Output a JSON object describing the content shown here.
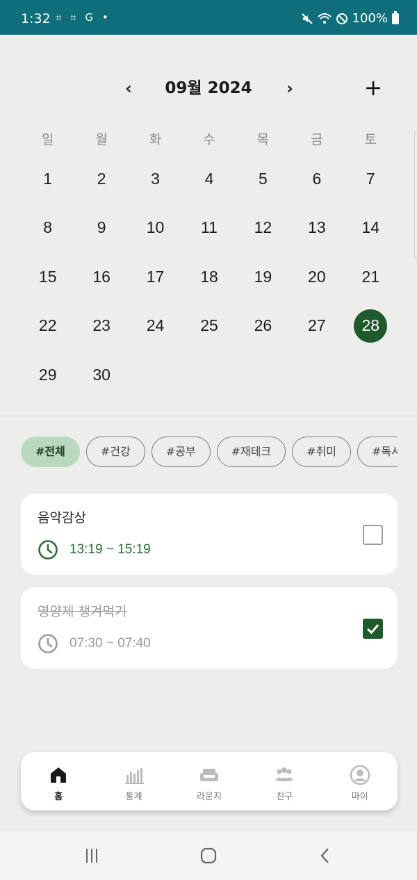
{
  "status_bar": {
    "time": "1:32",
    "left_icons": "⌗ ⌗ G •",
    "battery": "100%"
  },
  "calendar": {
    "title": "09월 2024",
    "prev": "‹",
    "next": "›",
    "add": "+",
    "weekdays": [
      "일",
      "월",
      "화",
      "수",
      "목",
      "금",
      "토"
    ],
    "days": [
      "1",
      "2",
      "3",
      "4",
      "5",
      "6",
      "7",
      "8",
      "9",
      "10",
      "11",
      "12",
      "13",
      "14",
      "15",
      "16",
      "17",
      "18",
      "19",
      "20",
      "21",
      "22",
      "23",
      "24",
      "25",
      "26",
      "27",
      "28",
      "29",
      "30"
    ],
    "selected_day": "28",
    "accent_color": "#1f5a2c"
  },
  "filters": {
    "chips": [
      {
        "label": "#전체",
        "active": true
      },
      {
        "label": "#건강",
        "active": false
      },
      {
        "label": "#공부",
        "active": false
      },
      {
        "label": "#재테크",
        "active": false
      },
      {
        "label": "#취미",
        "active": false
      },
      {
        "label": "#독서",
        "active": false
      }
    ]
  },
  "tasks": [
    {
      "title": "음악감상",
      "time": "13:19 ~ 15:19",
      "done": false
    },
    {
      "title": "영양제 챙겨먹기",
      "time": "07:30 ~ 07:40",
      "done": true
    }
  ],
  "bottom_nav": [
    {
      "label": "홈",
      "icon": "home-icon",
      "active": true
    },
    {
      "label": "통계",
      "icon": "bar-chart-icon",
      "active": false
    },
    {
      "label": "라운지",
      "icon": "sofa-icon",
      "active": false
    },
    {
      "label": "친구",
      "icon": "people-icon",
      "active": false
    },
    {
      "label": "마이",
      "icon": "profile-icon",
      "active": false
    }
  ]
}
